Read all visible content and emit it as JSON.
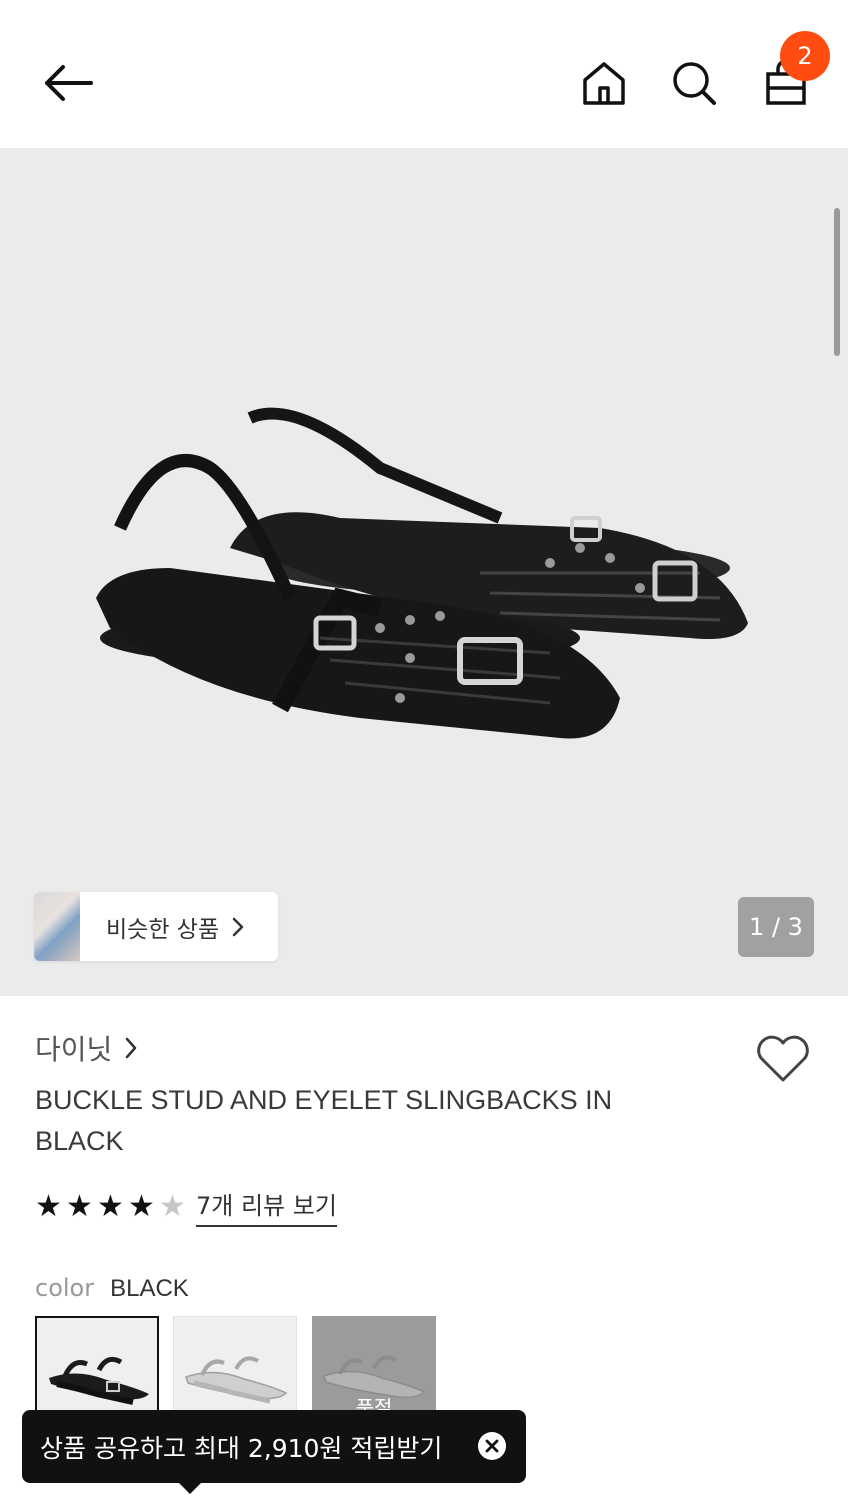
{
  "header": {
    "back_icon": "arrow-left-icon",
    "home_icon": "home-icon",
    "search_icon": "search-icon",
    "bag_icon": "shopping-bag-icon",
    "cart_count": "2",
    "badge_color": "#ff4d12"
  },
  "gallery": {
    "similar_label": "비슷한 상품",
    "counter": "1 / 3",
    "background": "#ebebeb"
  },
  "product": {
    "brand": "다이닛",
    "title": "BUCKLE STUD AND EYELET SLINGBACKS IN BLACK",
    "rating": 4,
    "rating_max": 5,
    "review_link": "7개 리뷰 보기",
    "color_label": "color",
    "color_value": "BLACK",
    "swatches": [
      {
        "name": "black",
        "selected": true
      },
      {
        "name": "silver",
        "selected": false
      },
      {
        "name": "grey",
        "selected": false,
        "status": "품절"
      }
    ]
  },
  "toast": {
    "text": "상품 공유하고 최대 2,910원 적립받기",
    "close_icon": "close-icon"
  }
}
